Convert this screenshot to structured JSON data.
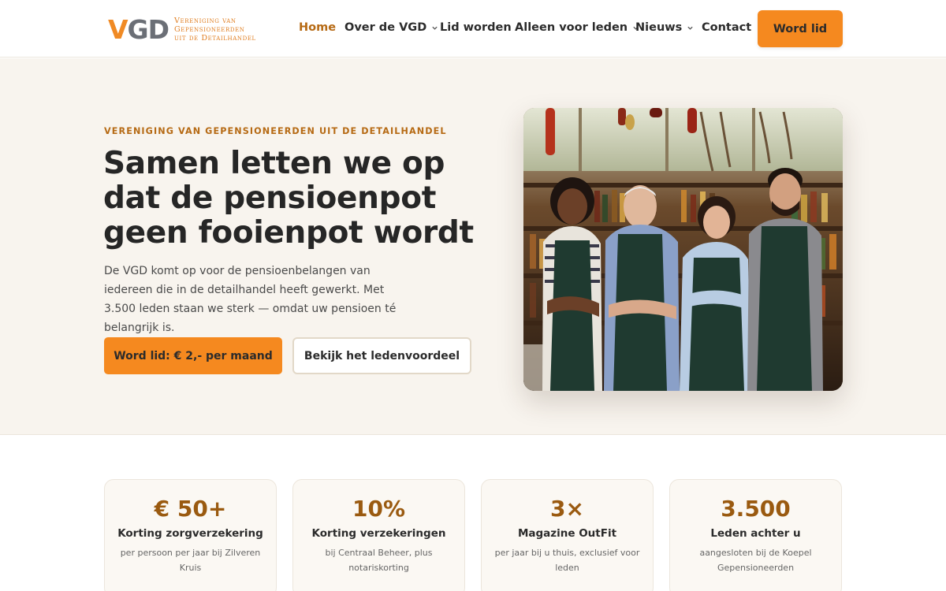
{
  "header": {
    "logo": {
      "mark_v": "V",
      "mark_gd": "GD",
      "lines": [
        "Vereniging van",
        "Gepensioneerden",
        "uit de Detailhandel"
      ]
    },
    "nav": [
      {
        "label": "Home",
        "active": true,
        "has_dropdown": false
      },
      {
        "label": "Over de VGD",
        "active": false,
        "has_dropdown": true
      },
      {
        "label": "Lid worden",
        "active": false,
        "has_dropdown": false
      },
      {
        "label": "Alleen voor leden",
        "active": false,
        "has_dropdown": true
      },
      {
        "label": "Nieuws",
        "active": false,
        "has_dropdown": true
      },
      {
        "label": "Contact",
        "active": false,
        "has_dropdown": false
      }
    ],
    "cta_label": "Word lid"
  },
  "hero": {
    "eyebrow": "VERENIGING VAN GEPENSIONEERDEN UIT DE DETAILHANDEL",
    "title": "Samen letten we op dat de pensioenpot geen fooienpot wordt",
    "subtitle": "De VGD komt op voor de pensioenbelangen van iedereen die in de detailhandel heeft gewerkt. Met 3.500 leden staan we sterk — omdat uw pensioen té belangrijk is.",
    "primary_button": "Word lid: € 2,- per maand",
    "secondary_button": "Bekijk het ledenvoordeel"
  },
  "stats": [
    {
      "value": "€ 50+",
      "label": "Korting zorgverzekering",
      "desc": "per persoon per jaar bij Zilveren Kruis"
    },
    {
      "value": "10%",
      "label": "Korting verzekeringen",
      "desc": "bij Centraal Beheer, plus notariskorting"
    },
    {
      "value": "3×",
      "label": "Magazine OutFit",
      "desc": "per jaar bij u thuis, exclusief voor leden"
    },
    {
      "value": "3.500",
      "label": "Leden achter u",
      "desc": "aangesloten bij de Koepel Gepensioneerden"
    }
  ],
  "colors": {
    "accent": "#f5891f",
    "accent_text": "#b66a14",
    "hero_bg": "#f8f4ee",
    "stat_value": "#9a5a10"
  }
}
